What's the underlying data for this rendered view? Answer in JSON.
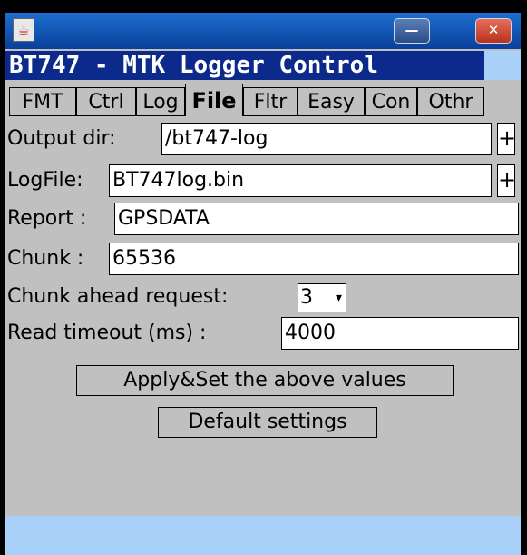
{
  "window": {
    "icon": "java-cup-icon",
    "minimize_label": "—",
    "close_label": "✕"
  },
  "app": {
    "title": "BT747 - MTK Logger Control"
  },
  "tabs": [
    {
      "label": "FMT"
    },
    {
      "label": "Ctrl"
    },
    {
      "label": "Log"
    },
    {
      "label": "File",
      "active": true
    },
    {
      "label": "Fltr"
    },
    {
      "label": "Easy"
    },
    {
      "label": "Con"
    },
    {
      "label": "Othr"
    }
  ],
  "form": {
    "output_dir": {
      "label": "Output dir:",
      "value": "/bt747-log",
      "add": "+"
    },
    "log_file": {
      "label": "LogFile:",
      "value": "BT747log.bin",
      "add": "+"
    },
    "report": {
      "label": "Report :",
      "value": "GPSDATA"
    },
    "chunk": {
      "label": "Chunk :",
      "value": "65536"
    },
    "chunk_ahead": {
      "label": "Chunk ahead request:",
      "value": "3"
    },
    "read_timeout": {
      "label": "Read timeout (ms) :",
      "value": "4000"
    }
  },
  "buttons": {
    "apply": "Apply&Set the above values",
    "defaults": "Default settings"
  },
  "colors": {
    "title_bg": "#0b2a8c",
    "status_bg": "#a9d0f8",
    "panel_bg": "#c0c0c0"
  }
}
